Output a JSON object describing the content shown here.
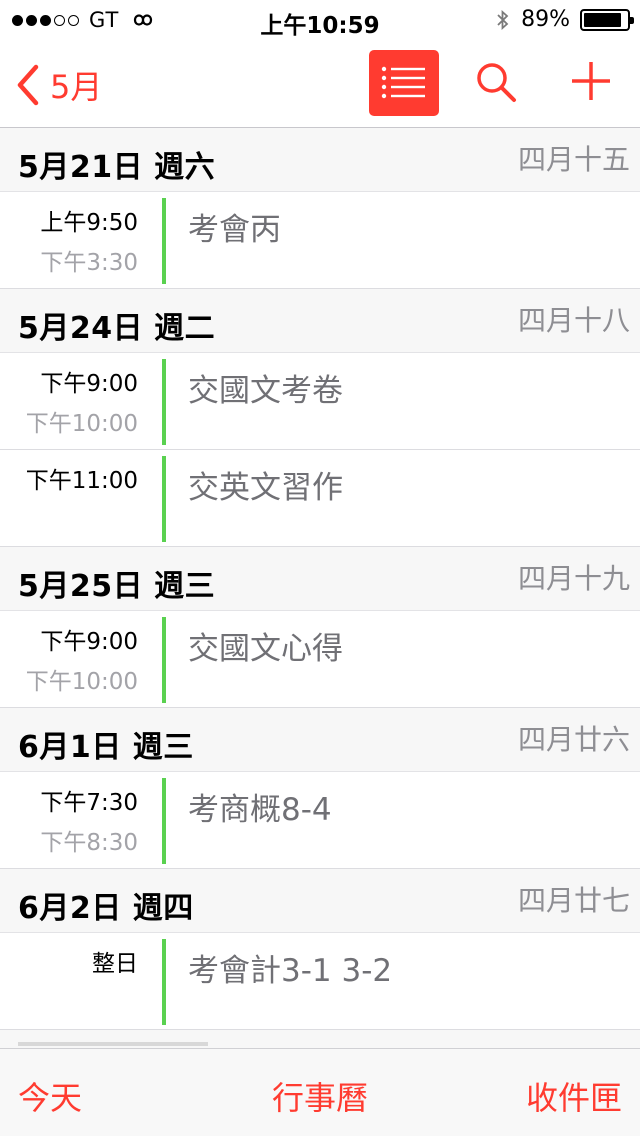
{
  "status_bar": {
    "signal_filled": 3,
    "signal_total": 5,
    "carrier": "GT",
    "time": "上午10:59",
    "battery_percent": "89%",
    "battery_level": 0.89
  },
  "nav": {
    "back_label": "5月",
    "accent_color": "#ff3b30"
  },
  "days": [
    {
      "date": "5月21日 週六",
      "lunar": "四月十五",
      "events": [
        {
          "start": "上午9:50",
          "end": "下午3:30",
          "title": "考會丙"
        }
      ]
    },
    {
      "date": "5月24日 週二",
      "lunar": "四月十八",
      "events": [
        {
          "start": "下午9:00",
          "end": "下午10:00",
          "title": "交國文考卷"
        },
        {
          "start": "下午11:00",
          "end": "",
          "title": "交英文習作"
        }
      ]
    },
    {
      "date": "5月25日 週三",
      "lunar": "四月十九",
      "events": [
        {
          "start": "下午9:00",
          "end": "下午10:00",
          "title": "交國文心得"
        }
      ]
    },
    {
      "date": "6月1日 週三",
      "lunar": "四月廿六",
      "events": [
        {
          "start": "下午7:30",
          "end": "下午8:30",
          "title": "考商概8-4"
        }
      ]
    },
    {
      "date": "6月2日 週四",
      "lunar": "四月廿七",
      "events": [
        {
          "start": "整日",
          "end": "",
          "title": "考會計3-1 3-2"
        }
      ]
    }
  ],
  "event_bar_color": "#5ad150",
  "tabs": {
    "today": "今天",
    "calendars": "行事曆",
    "inbox": "收件匣"
  }
}
